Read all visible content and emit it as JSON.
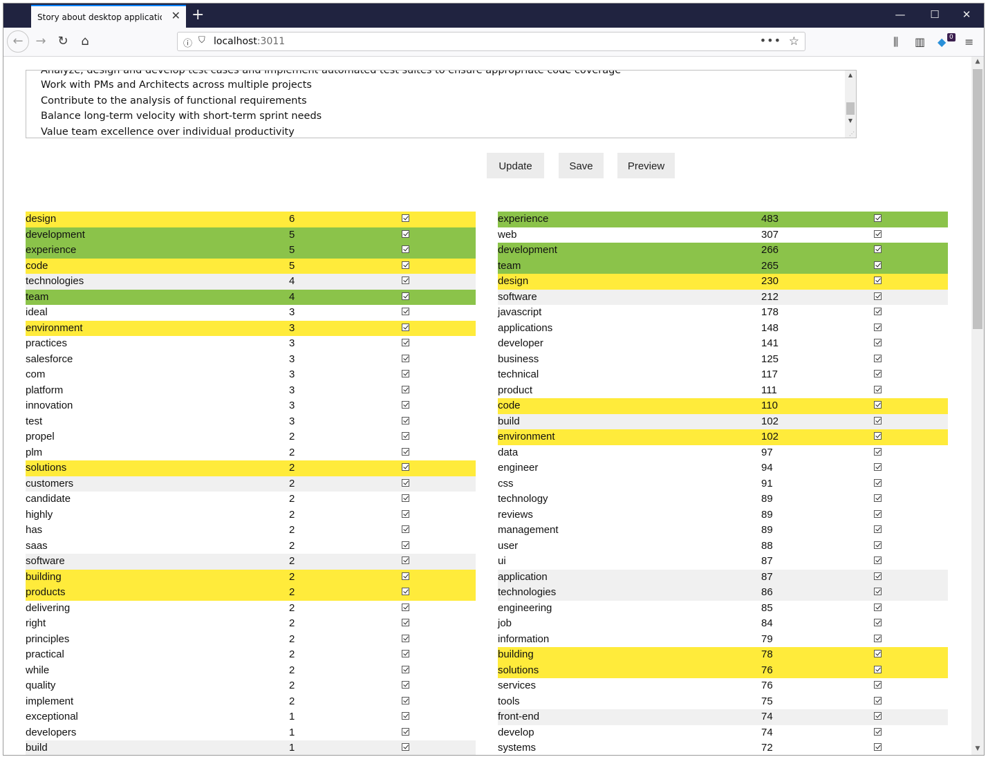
{
  "browser": {
    "tab_title": "Story about desktop application...",
    "tab_close": "✕",
    "new_tab": "+",
    "url_host": "localhost",
    "url_port": ":3011",
    "minimize": "—",
    "maximize": "☐",
    "close": "✕",
    "notification_badge": "0"
  },
  "textarea": {
    "lines": [
      "Analyze, design and develop test cases and implement automated test suites to ensure appropriate code coverage",
      "Work with PMs and Architects across multiple projects",
      "Contribute to the analysis of functional requirements",
      "Balance long-term velocity with short-term sprint needs",
      "Value team excellence over individual productivity"
    ]
  },
  "buttons": {
    "update": "Update",
    "save": "Save",
    "preview": "Preview"
  },
  "left_table": [
    {
      "word": "design",
      "count": "6",
      "hl": "yellow"
    },
    {
      "word": "development",
      "count": "5",
      "hl": "green"
    },
    {
      "word": "experience",
      "count": "5",
      "hl": "green"
    },
    {
      "word": "code",
      "count": "5",
      "hl": "yellow"
    },
    {
      "word": "technologies",
      "count": "4",
      "hl": "gray"
    },
    {
      "word": "team",
      "count": "4",
      "hl": "green"
    },
    {
      "word": "ideal",
      "count": "3",
      "hl": ""
    },
    {
      "word": "environment",
      "count": "3",
      "hl": "yellow"
    },
    {
      "word": "practices",
      "count": "3",
      "hl": ""
    },
    {
      "word": "salesforce",
      "count": "3",
      "hl": ""
    },
    {
      "word": "com",
      "count": "3",
      "hl": ""
    },
    {
      "word": "platform",
      "count": "3",
      "hl": ""
    },
    {
      "word": "innovation",
      "count": "3",
      "hl": ""
    },
    {
      "word": "test",
      "count": "3",
      "hl": ""
    },
    {
      "word": "propel",
      "count": "2",
      "hl": ""
    },
    {
      "word": "plm",
      "count": "2",
      "hl": ""
    },
    {
      "word": "solutions",
      "count": "2",
      "hl": "yellow"
    },
    {
      "word": "customers",
      "count": "2",
      "hl": "gray"
    },
    {
      "word": "candidate",
      "count": "2",
      "hl": ""
    },
    {
      "word": "highly",
      "count": "2",
      "hl": ""
    },
    {
      "word": "has",
      "count": "2",
      "hl": ""
    },
    {
      "word": "saas",
      "count": "2",
      "hl": ""
    },
    {
      "word": "software",
      "count": "2",
      "hl": "gray"
    },
    {
      "word": "building",
      "count": "2",
      "hl": "yellow"
    },
    {
      "word": "products",
      "count": "2",
      "hl": "yellow"
    },
    {
      "word": "delivering",
      "count": "2",
      "hl": ""
    },
    {
      "word": "right",
      "count": "2",
      "hl": ""
    },
    {
      "word": "principles",
      "count": "2",
      "hl": ""
    },
    {
      "word": "practical",
      "count": "2",
      "hl": ""
    },
    {
      "word": "while",
      "count": "2",
      "hl": ""
    },
    {
      "word": "quality",
      "count": "2",
      "hl": ""
    },
    {
      "word": "implement",
      "count": "2",
      "hl": ""
    },
    {
      "word": "exceptional",
      "count": "1",
      "hl": ""
    },
    {
      "word": "developers",
      "count": "1",
      "hl": ""
    },
    {
      "word": "build",
      "count": "1",
      "hl": "gray"
    }
  ],
  "right_table": [
    {
      "word": "experience",
      "count": "483",
      "hl": "green"
    },
    {
      "word": "web",
      "count": "307",
      "hl": ""
    },
    {
      "word": "development",
      "count": "266",
      "hl": "green"
    },
    {
      "word": "team",
      "count": "265",
      "hl": "green"
    },
    {
      "word": "design",
      "count": "230",
      "hl": "yellow"
    },
    {
      "word": "software",
      "count": "212",
      "hl": "gray"
    },
    {
      "word": "javascript",
      "count": "178",
      "hl": ""
    },
    {
      "word": "applications",
      "count": "148",
      "hl": ""
    },
    {
      "word": "developer",
      "count": "141",
      "hl": ""
    },
    {
      "word": "business",
      "count": "125",
      "hl": ""
    },
    {
      "word": "technical",
      "count": "117",
      "hl": ""
    },
    {
      "word": "product",
      "count": "111",
      "hl": ""
    },
    {
      "word": "code",
      "count": "110",
      "hl": "yellow"
    },
    {
      "word": "build",
      "count": "102",
      "hl": "gray"
    },
    {
      "word": "environment",
      "count": "102",
      "hl": "yellow"
    },
    {
      "word": "data",
      "count": "97",
      "hl": ""
    },
    {
      "word": "engineer",
      "count": "94",
      "hl": ""
    },
    {
      "word": "css",
      "count": "91",
      "hl": ""
    },
    {
      "word": "technology",
      "count": "89",
      "hl": ""
    },
    {
      "word": "reviews",
      "count": "89",
      "hl": ""
    },
    {
      "word": "management",
      "count": "89",
      "hl": ""
    },
    {
      "word": "user",
      "count": "88",
      "hl": ""
    },
    {
      "word": "ui",
      "count": "87",
      "hl": ""
    },
    {
      "word": "application",
      "count": "87",
      "hl": "gray"
    },
    {
      "word": "technologies",
      "count": "86",
      "hl": "gray"
    },
    {
      "word": "engineering",
      "count": "85",
      "hl": ""
    },
    {
      "word": "job",
      "count": "84",
      "hl": ""
    },
    {
      "word": "information",
      "count": "79",
      "hl": ""
    },
    {
      "word": "building",
      "count": "78",
      "hl": "yellow"
    },
    {
      "word": "solutions",
      "count": "76",
      "hl": "yellow"
    },
    {
      "word": "services",
      "count": "76",
      "hl": ""
    },
    {
      "word": "tools",
      "count": "75",
      "hl": ""
    },
    {
      "word": "front-end",
      "count": "74",
      "hl": "gray"
    },
    {
      "word": "develop",
      "count": "74",
      "hl": ""
    },
    {
      "word": "systems",
      "count": "72",
      "hl": ""
    }
  ],
  "colors": {
    "yellow": "#ffeb3b",
    "green": "#8bc34a",
    "gray": "#f0f0f0",
    "titlebar": "#202340"
  }
}
